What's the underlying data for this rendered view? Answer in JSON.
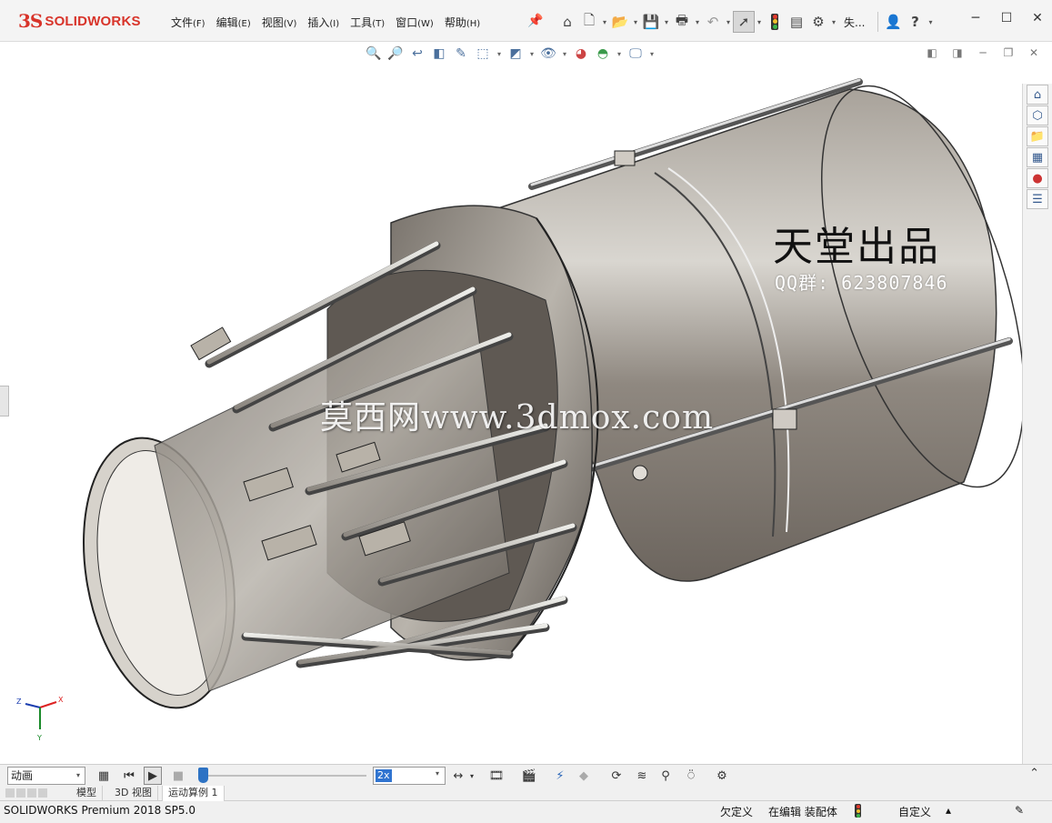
{
  "app": {
    "logo_text": "SOLIDWORKS",
    "logo_mark": "3S"
  },
  "menu": {
    "items": [
      {
        "label": "文件",
        "key": "(F)"
      },
      {
        "label": "编辑",
        "key": "(E)"
      },
      {
        "label": "视图",
        "key": "(V)"
      },
      {
        "label": "插入",
        "key": "(I)"
      },
      {
        "label": "工具",
        "key": "(T)"
      },
      {
        "label": "窗口",
        "key": "(W)"
      },
      {
        "label": "帮助",
        "key": "(H)"
      }
    ],
    "search_short": "失..."
  },
  "graphics": {
    "watermark_title": "天堂出品",
    "watermark_qq": "QQ群: 623807846",
    "watermark_site": "莫西网www.3dmox.com",
    "triad_labels": {
      "x": "X",
      "y": "Y",
      "z": "Z"
    }
  },
  "motion": {
    "study_type": "动画",
    "speed": "2x"
  },
  "tabs": {
    "model": "模型",
    "view3d": "3D 视图",
    "motion_study": "运动算例 1"
  },
  "status": {
    "product": "SOLIDWORKS Premium 2018 SP5.0",
    "underdefined": "欠定义",
    "editing": "在编辑 装配体",
    "units": "自定义"
  },
  "colors": {
    "brand": "#d8342a",
    "selection_blue": "#3074d0",
    "model_metal": "#9a948c"
  }
}
